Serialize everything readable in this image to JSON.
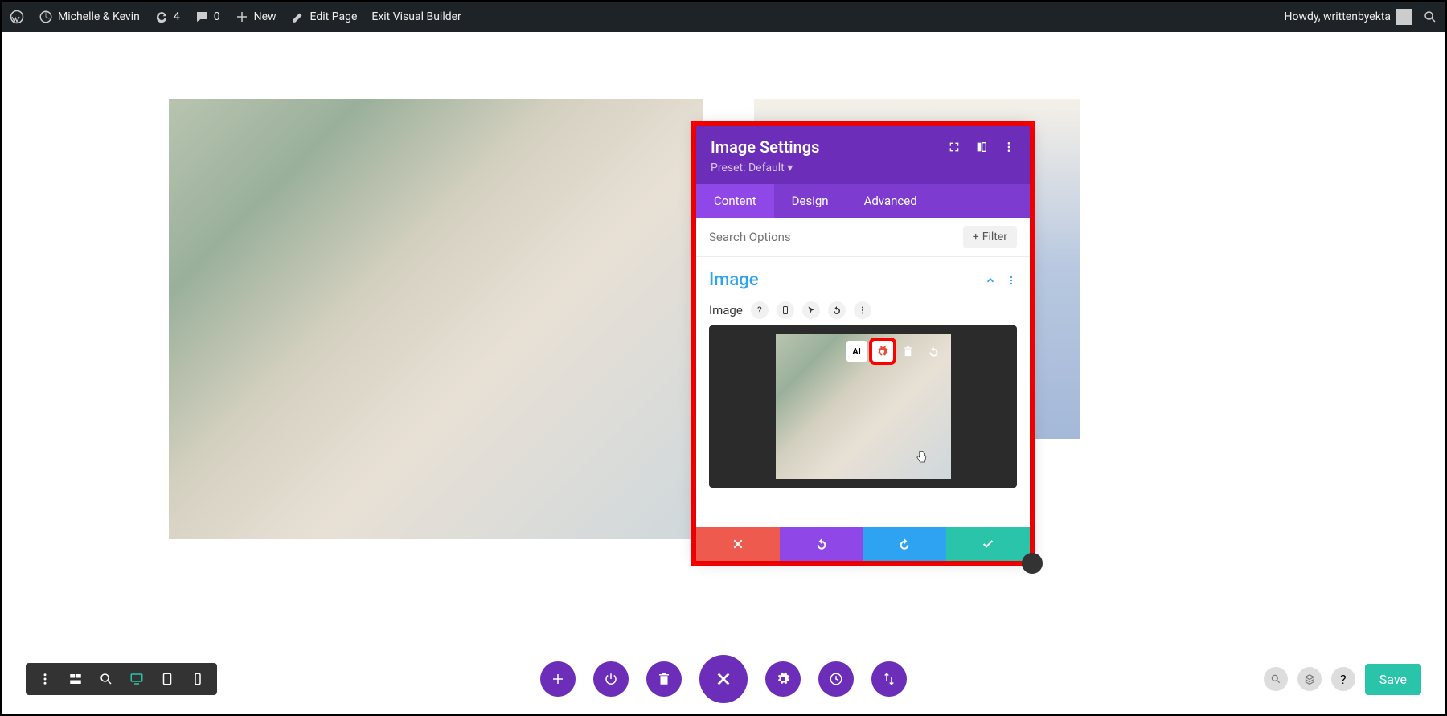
{
  "admin_bar": {
    "site_title": "Michelle & Kevin",
    "updates_count": "4",
    "comments_count": "0",
    "new_label": "New",
    "edit_page": "Edit Page",
    "exit_vb": "Exit Visual Builder",
    "greeting": "Howdy, writtenbyekta"
  },
  "modal": {
    "title": "Image Settings",
    "preset": "Preset: Default",
    "tabs": {
      "content": "Content",
      "design": "Design",
      "advanced": "Advanced"
    },
    "search_placeholder": "Search Options",
    "filter_label": "Filter",
    "section_title": "Image",
    "field_label": "Image",
    "thumb_ai_label": "AI"
  },
  "bottom": {
    "save_label": "Save"
  }
}
